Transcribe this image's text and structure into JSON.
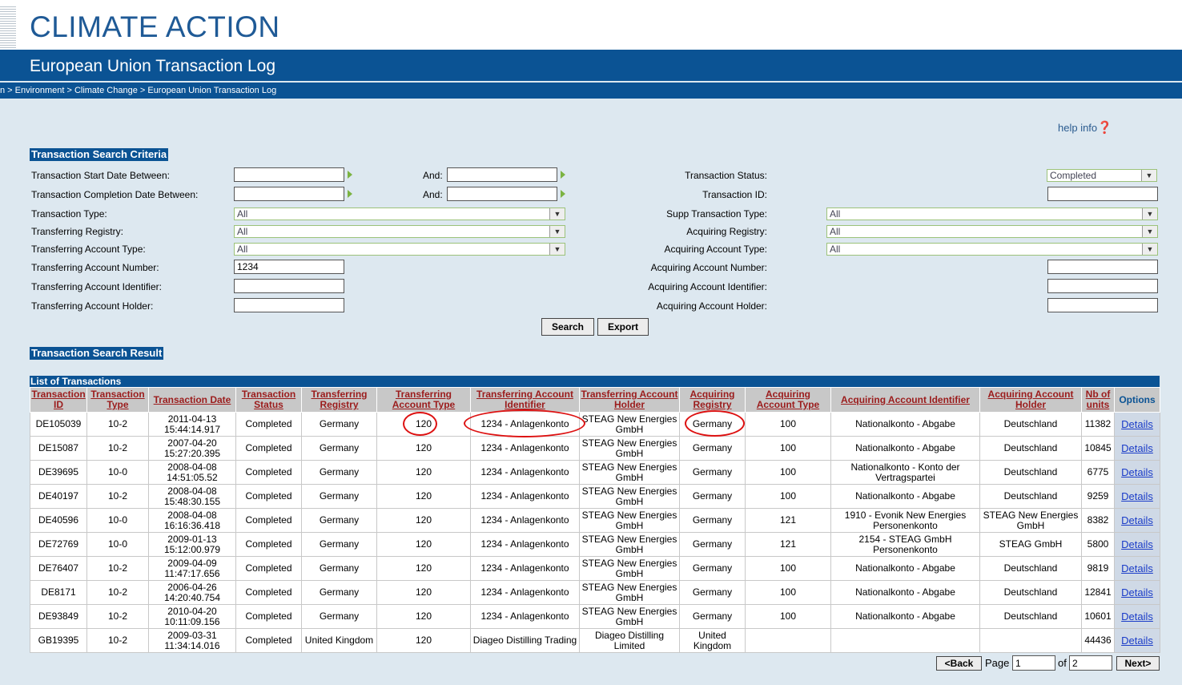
{
  "header": {
    "site_title": "CLIMATE ACTION",
    "banner_title": "European Union Transaction Log",
    "breadcrumb": "n > Environment > Climate Change > European Union Transaction Log"
  },
  "help": {
    "label": "help info",
    "icon": "question-icon",
    "glyph": "❓"
  },
  "search": {
    "title": "Transaction Search Criteria",
    "start_date_label": "Transaction Start Date Between:",
    "completion_date_label": "Transaction Completion Date Between:",
    "and_label": "And:",
    "status_label": "Transaction Status:",
    "status_value": "Completed",
    "id_label": "Transaction ID:",
    "type_label": "Transaction Type:",
    "type_value": "All",
    "supp_type_label": "Supp Transaction Type:",
    "supp_type_value": "All",
    "transferring_registry_label": "Transferring Registry:",
    "transferring_registry_value": "All",
    "acquiring_registry_label": "Acquiring Registry:",
    "acquiring_registry_value": "All",
    "transferring_account_type_label": "Transferring Account Type:",
    "transferring_account_type_value": "All",
    "acquiring_account_type_label": "Acquiring Account Type:",
    "acquiring_account_type_value": "All",
    "transferring_account_number_label": "Transferring Account Number:",
    "transferring_account_number_value": "1234",
    "acquiring_account_number_label": "Acquiring Account Number:",
    "transferring_account_identifier_label": "Transferring Account Identifier:",
    "acquiring_account_identifier_label": "Acquiring Account Identifier:",
    "transferring_account_holder_label": "Transferring Account Holder:",
    "acquiring_account_holder_label": "Acquiring Account Holder:",
    "search_button": "Search",
    "export_button": "Export"
  },
  "result": {
    "title": "Transaction Search Result",
    "caption": "List of Transactions",
    "columns": [
      "Transaction ID",
      "Transaction Type",
      "Transaction Date",
      "Transaction Status",
      "Transferring Registry",
      "Transferring Account Type",
      "Transferring Account Identifier",
      "Transferring Account Holder",
      "Acquiring Registry",
      "Acquiring Account Type",
      "Acquiring Account Identifier",
      "Acquiring Account Holder",
      "Nb of units",
      "Options"
    ],
    "details_label": "Details",
    "rows": [
      [
        "DE105039",
        "10-2",
        "2011-04-13 15:44:14.917",
        "Completed",
        "Germany",
        "120",
        "1234 - Anlagenkonto",
        "STEAG New Energies GmbH",
        "Germany",
        "100",
        "Nationalkonto - Abgabe",
        "Deutschland",
        "11382"
      ],
      [
        "DE15087",
        "10-2",
        "2007-04-20 15:27:20.395",
        "Completed",
        "Germany",
        "120",
        "1234 - Anlagenkonto",
        "STEAG New Energies GmbH",
        "Germany",
        "100",
        "Nationalkonto - Abgabe",
        "Deutschland",
        "10845"
      ],
      [
        "DE39695",
        "10-0",
        "2008-04-08 14:51:05.52",
        "Completed",
        "Germany",
        "120",
        "1234 - Anlagenkonto",
        "STEAG New Energies GmbH",
        "Germany",
        "100",
        "Nationalkonto - Konto der Vertragspartei",
        "Deutschland",
        "6775"
      ],
      [
        "DE40197",
        "10-2",
        "2008-04-08 15:48:30.155",
        "Completed",
        "Germany",
        "120",
        "1234 - Anlagenkonto",
        "STEAG New Energies GmbH",
        "Germany",
        "100",
        "Nationalkonto - Abgabe",
        "Deutschland",
        "9259"
      ],
      [
        "DE40596",
        "10-0",
        "2008-04-08 16:16:36.418",
        "Completed",
        "Germany",
        "120",
        "1234 - Anlagenkonto",
        "STEAG New Energies GmbH",
        "Germany",
        "121",
        "1910 - Evonik New Energies Personenkonto",
        "STEAG New Energies GmbH",
        "8382"
      ],
      [
        "DE72769",
        "10-0",
        "2009-01-13 15:12:00.979",
        "Completed",
        "Germany",
        "120",
        "1234 - Anlagenkonto",
        "STEAG New Energies GmbH",
        "Germany",
        "121",
        "2154 - STEAG GmbH Personenkonto",
        "STEAG GmbH",
        "5800"
      ],
      [
        "DE76407",
        "10-2",
        "2009-04-09 11:47:17.656",
        "Completed",
        "Germany",
        "120",
        "1234 - Anlagenkonto",
        "STEAG New Energies GmbH",
        "Germany",
        "100",
        "Nationalkonto - Abgabe",
        "Deutschland",
        "9819"
      ],
      [
        "DE8171",
        "10-2",
        "2006-04-26 14:20:40.754",
        "Completed",
        "Germany",
        "120",
        "1234 - Anlagenkonto",
        "STEAG New Energies GmbH",
        "Germany",
        "100",
        "Nationalkonto - Abgabe",
        "Deutschland",
        "12841"
      ],
      [
        "DE93849",
        "10-2",
        "2010-04-20 10:11:09.156",
        "Completed",
        "Germany",
        "120",
        "1234 - Anlagenkonto",
        "STEAG New Energies GmbH",
        "Germany",
        "100",
        "Nationalkonto - Abgabe",
        "Deutschland",
        "10601"
      ],
      [
        "GB19395",
        "10-2",
        "2009-03-31 11:34:14.016",
        "Completed",
        "United Kingdom",
        "120",
        "Diageo Distilling Trading",
        "Diageo Distilling Limited",
        "United Kingdom",
        "",
        "",
        "",
        "44436"
      ]
    ]
  },
  "pager": {
    "back_button": "<Back",
    "page_label": "Page",
    "page_value": "1",
    "of_label": "of",
    "total_pages": "2",
    "next_button": "Next>"
  },
  "colors": {
    "brand": "#0b5394",
    "annotation": "#d11111",
    "link": "#1a3cc8",
    "header_link": "#9b1c1c"
  }
}
